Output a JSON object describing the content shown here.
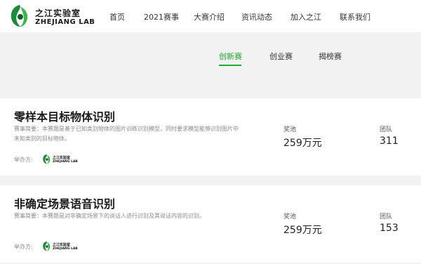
{
  "brand": {
    "name_cn": "之江实验室",
    "name_en": "ZHEJIANG LAB"
  },
  "nav": {
    "items": [
      {
        "label": "首页"
      },
      {
        "label": "2021赛事"
      },
      {
        "label": "大赛介绍"
      },
      {
        "label": "资讯动态"
      },
      {
        "label": "加入之江"
      },
      {
        "label": "联系我们"
      }
    ]
  },
  "tabs": {
    "items": [
      {
        "label": "创新赛",
        "active": true
      },
      {
        "label": "创业赛",
        "active": false
      },
      {
        "label": "揭榜赛",
        "active": false
      }
    ]
  },
  "competitions": [
    {
      "title": "零样本目标物体识别",
      "description": "赛事简要：本赛题是基于已知类别物体的图片训练识别模型，同时要求模型能够识别图片中未知类别的目标物体。",
      "organizer_label": "举办方:",
      "prize_label": "奖池",
      "prize_value": "259万元",
      "team_label": "团队",
      "team_value": "311"
    },
    {
      "title": "非确定场景语音识别",
      "description": "赛事简要：本赛题是对非确定场景下的说话人进行识别及其说话内容的识别。",
      "organizer_label": "举办方:",
      "prize_label": "奖池",
      "prize_value": "259万元",
      "team_label": "团队",
      "team_value": "153"
    }
  ],
  "colors": {
    "accent": "#20a82f",
    "page_background": "#f2f2f2",
    "card_background": "#ffffff",
    "logo_green": "#1f8a3a"
  },
  "icons": {
    "brand_logo": "zhejiang-lab-logo-icon",
    "organizer_logo": "zhejiang-lab-logo-icon"
  }
}
